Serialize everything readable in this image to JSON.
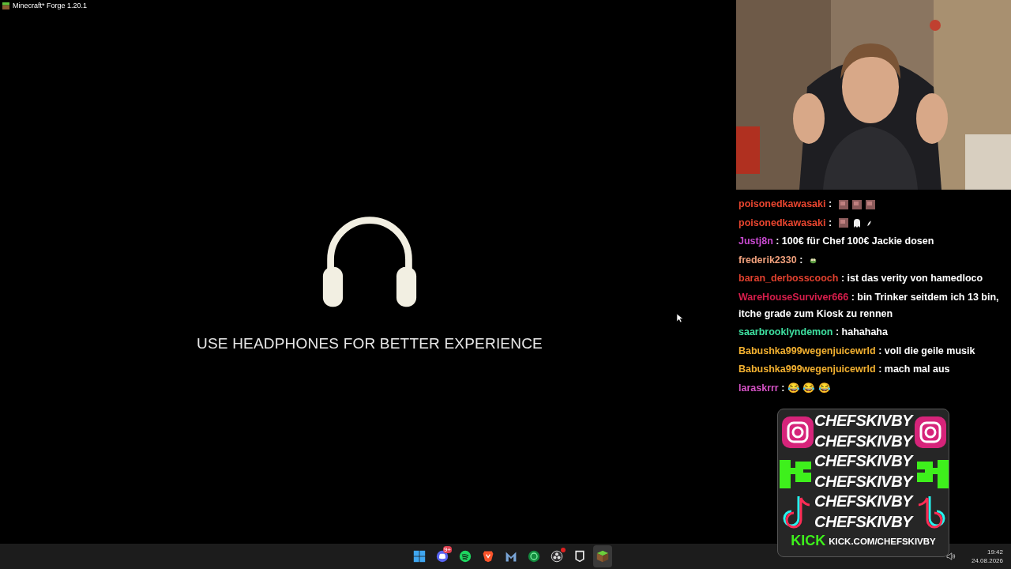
{
  "window": {
    "title": "Minecraft* Forge 1.20.1"
  },
  "game": {
    "message": "USE HEADPHONES FOR BETTER EXPERIENCE"
  },
  "chat": [
    {
      "user": "poisonedkawasaki",
      "color": "#e8452f",
      "separator": ":",
      "emotes": [
        {
          "kind": "square"
        },
        {
          "kind": "square"
        },
        {
          "kind": "square"
        }
      ]
    },
    {
      "user": "poisonedkawasaki",
      "color": "#e8452f",
      "separator": ":",
      "emotes": [
        {
          "kind": "square"
        },
        {
          "kind": "ghost"
        },
        {
          "kind": "feather"
        }
      ]
    },
    {
      "user": "Justj8n",
      "color": "#c84ad0",
      "separator": ":",
      "text": "100€ für Chef 100€ Jackie dosen"
    },
    {
      "user": "frederik2330",
      "color": "#f0a07c",
      "separator": ":",
      "emotes": [
        {
          "kind": "frog"
        }
      ]
    },
    {
      "user": "baran_derbosscooch",
      "color": "#e0402e",
      "separator": ":",
      "text": "ist das verity von hamedloco"
    },
    {
      "user": "WareHouseSurviver666",
      "color": "#d81e4c",
      "separator": ":",
      "text": "bin Trinker seitdem ich 13 bin, itche grade zum Kiosk zu rennen"
    },
    {
      "user": "saarbrooklyndemon",
      "color": "#3ee0a0",
      "separator": ":",
      "text": "hahahaha"
    },
    {
      "user": "Babushka999wegenjuicewrld",
      "color": "#f2b030",
      "separator": ":",
      "text": "voll die geile musik"
    },
    {
      "user": "Babushka999wegenjuicewrld",
      "color": "#f2b030",
      "separator": ":",
      "text": "mach mal aus"
    },
    {
      "user": "laraskrrr",
      "color": "#d452c4",
      "separator": ":",
      "text": "😂 😂 😂"
    }
  ],
  "overlay": {
    "handles": [
      "CHEFSKIVBY",
      "CHEFSKIVBY",
      "CHEFSKIVBY",
      "CHEFSKIVBY",
      "CHEFSKIVBY",
      "CHEFSKIVBY"
    ],
    "logo": "KICK",
    "url": "KICK.COM/CHEFSKIVBY"
  },
  "taskbar": {
    "apps": [
      {
        "kind": "windows",
        "selected": false,
        "notification": false
      },
      {
        "kind": "discord",
        "badge": "9+",
        "selected": false,
        "notification": false
      },
      {
        "kind": "spotify",
        "selected": false,
        "notification": false
      },
      {
        "kind": "brave",
        "selected": false,
        "notification": false
      },
      {
        "kind": "m",
        "selected": false,
        "notification": false
      },
      {
        "kind": "green-circle",
        "selected": false,
        "notification": false
      },
      {
        "kind": "obs",
        "selected": false,
        "notification": true
      },
      {
        "kind": "epic",
        "selected": false,
        "notification": false
      },
      {
        "kind": "minecraft",
        "selected": true,
        "notification": false
      }
    ],
    "time": "19:42",
    "date": "24.08.2026"
  }
}
